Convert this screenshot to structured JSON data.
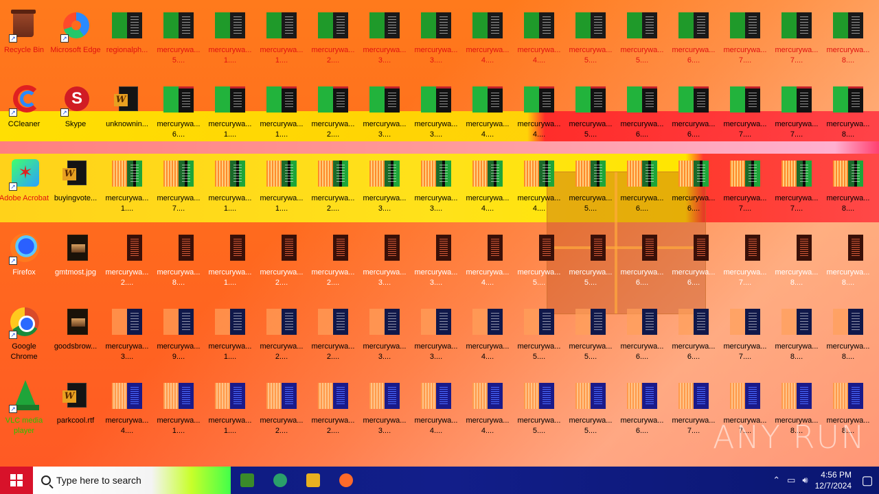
{
  "desktop": {
    "row1": [
      {
        "label": "Recycle Bin",
        "kind": "bin",
        "color": "red"
      },
      {
        "label": "Microsoft Edge",
        "kind": "edge",
        "color": "red"
      },
      {
        "label": "regionalph...",
        "kind": "file",
        "color": "red"
      },
      {
        "label": "mercurywa... 5....",
        "kind": "file",
        "color": "red"
      },
      {
        "label": "mercurywa... 1....",
        "kind": "file",
        "color": "red"
      },
      {
        "label": "mercurywa... 1....",
        "kind": "file",
        "color": "red"
      },
      {
        "label": "mercurywa... 2....",
        "kind": "file",
        "color": "red"
      },
      {
        "label": "mercurywa... 3....",
        "kind": "file",
        "color": "red"
      },
      {
        "label": "mercurywa... 3....",
        "kind": "file",
        "color": "red"
      },
      {
        "label": "mercurywa... 4....",
        "kind": "file",
        "color": "red"
      },
      {
        "label": "mercurywa... 4....",
        "kind": "file",
        "color": "red"
      },
      {
        "label": "mercurywa... 5....",
        "kind": "file",
        "color": "red"
      },
      {
        "label": "mercurywa... 5....",
        "kind": "file",
        "color": "red"
      },
      {
        "label": "mercurywa... 6....",
        "kind": "file",
        "color": "red"
      },
      {
        "label": "mercurywa... 7....",
        "kind": "file",
        "color": "red"
      },
      {
        "label": "mercurywa... 7....",
        "kind": "file",
        "color": "red"
      },
      {
        "label": "mercurywa... 8....",
        "kind": "file",
        "color": "red"
      }
    ],
    "row2": [
      {
        "label": "CCleaner",
        "kind": "ccleaner"
      },
      {
        "label": "Skype",
        "kind": "skype"
      },
      {
        "label": "unknownin...",
        "kind": "word"
      },
      {
        "label": "mercurywa... 6....",
        "kind": "file"
      },
      {
        "label": "mercurywa... 1....",
        "kind": "file"
      },
      {
        "label": "mercurywa... 1....",
        "kind": "file"
      },
      {
        "label": "mercurywa... 2....",
        "kind": "file"
      },
      {
        "label": "mercurywa... 3....",
        "kind": "file"
      },
      {
        "label": "mercurywa... 3....",
        "kind": "file"
      },
      {
        "label": "mercurywa... 4....",
        "kind": "file"
      },
      {
        "label": "mercurywa... 4....",
        "kind": "file"
      },
      {
        "label": "mercurywa... 5....",
        "kind": "file"
      },
      {
        "label": "mercurywa... 6....",
        "kind": "file"
      },
      {
        "label": "mercurywa... 6....",
        "kind": "file"
      },
      {
        "label": "mercurywa... 7....",
        "kind": "file"
      },
      {
        "label": "mercurywa... 7....",
        "kind": "file"
      },
      {
        "label": "mercurywa... 8....",
        "kind": "file"
      }
    ],
    "row3": [
      {
        "label": "Adobe Acrobat",
        "kind": "acrobat"
      },
      {
        "label": "buyingvote...",
        "kind": "word"
      },
      {
        "label": "mercurywa... 1....",
        "kind": "file"
      },
      {
        "label": "mercurywa... 7....",
        "kind": "file"
      },
      {
        "label": "mercurywa... 1....",
        "kind": "file"
      },
      {
        "label": "mercurywa... 1....",
        "kind": "file"
      },
      {
        "label": "mercurywa... 2....",
        "kind": "file"
      },
      {
        "label": "mercurywa... 3....",
        "kind": "file"
      },
      {
        "label": "mercurywa... 3....",
        "kind": "file"
      },
      {
        "label": "mercurywa... 4....",
        "kind": "file"
      },
      {
        "label": "mercurywa... 4....",
        "kind": "file"
      },
      {
        "label": "mercurywa... 5....",
        "kind": "file"
      },
      {
        "label": "mercurywa... 6....",
        "kind": "file"
      },
      {
        "label": "mercurywa... 6....",
        "kind": "file"
      },
      {
        "label": "mercurywa... 7....",
        "kind": "file"
      },
      {
        "label": "mercurywa... 7....",
        "kind": "file"
      },
      {
        "label": "mercurywa... 8....",
        "kind": "file"
      }
    ],
    "row4": [
      {
        "label": "Firefox",
        "kind": "firefox"
      },
      {
        "label": "gmtmost.jpg",
        "kind": "image"
      },
      {
        "label": "mercurywa... 2....",
        "kind": "file"
      },
      {
        "label": "mercurywa... 8....",
        "kind": "file"
      },
      {
        "label": "mercurywa... 1....",
        "kind": "file"
      },
      {
        "label": "mercurywa... 2....",
        "kind": "file"
      },
      {
        "label": "mercurywa... 2....",
        "kind": "file"
      },
      {
        "label": "mercurywa... 3....",
        "kind": "file"
      },
      {
        "label": "mercurywa... 3....",
        "kind": "file"
      },
      {
        "label": "mercurywa... 4....",
        "kind": "file"
      },
      {
        "label": "mercurywa... 5....",
        "kind": "file"
      },
      {
        "label": "mercurywa... 5....",
        "kind": "file"
      },
      {
        "label": "mercurywa... 6....",
        "kind": "file"
      },
      {
        "label": "mercurywa... 6....",
        "kind": "file"
      },
      {
        "label": "mercurywa... 7....",
        "kind": "file"
      },
      {
        "label": "mercurywa... 8....",
        "kind": "file"
      },
      {
        "label": "mercurywa... 8....",
        "kind": "file"
      }
    ],
    "row5": [
      {
        "label": "Google Chrome",
        "kind": "chrome"
      },
      {
        "label": "goodsbrow...",
        "kind": "image"
      },
      {
        "label": "mercurywa... 3....",
        "kind": "file"
      },
      {
        "label": "mercurywa... 9....",
        "kind": "file"
      },
      {
        "label": "mercurywa... 1....",
        "kind": "file"
      },
      {
        "label": "mercurywa... 2....",
        "kind": "file"
      },
      {
        "label": "mercurywa... 2....",
        "kind": "file"
      },
      {
        "label": "mercurywa... 3....",
        "kind": "file"
      },
      {
        "label": "mercurywa... 3....",
        "kind": "file"
      },
      {
        "label": "mercurywa... 4....",
        "kind": "file"
      },
      {
        "label": "mercurywa... 5....",
        "kind": "file"
      },
      {
        "label": "mercurywa... 5....",
        "kind": "file"
      },
      {
        "label": "mercurywa... 6....",
        "kind": "file"
      },
      {
        "label": "mercurywa... 6....",
        "kind": "file"
      },
      {
        "label": "mercurywa... 7....",
        "kind": "file"
      },
      {
        "label": "mercurywa... 8....",
        "kind": "file"
      },
      {
        "label": "mercurywa... 8....",
        "kind": "file"
      }
    ],
    "row6": [
      {
        "label": "VLC media player",
        "kind": "vlc"
      },
      {
        "label": "parkcool.rtf",
        "kind": "word"
      },
      {
        "label": "mercurywa... 4....",
        "kind": "file"
      },
      {
        "label": "mercurywa... 1....",
        "kind": "file"
      },
      {
        "label": "mercurywa... 1....",
        "kind": "file"
      },
      {
        "label": "mercurywa... 2....",
        "kind": "file"
      },
      {
        "label": "mercurywa... 2....",
        "kind": "file"
      },
      {
        "label": "mercurywa... 3....",
        "kind": "file"
      },
      {
        "label": "mercurywa... 4....",
        "kind": "file"
      },
      {
        "label": "mercurywa... 4....",
        "kind": "file"
      },
      {
        "label": "mercurywa... 5....",
        "kind": "file"
      },
      {
        "label": "mercurywa... 5....",
        "kind": "file"
      },
      {
        "label": "mercurywa... 6....",
        "kind": "file"
      },
      {
        "label": "mercurywa... 7....",
        "kind": "file"
      },
      {
        "label": "mercurywa... 7....",
        "kind": "file"
      },
      {
        "label": "mercurywa... 8....",
        "kind": "file"
      },
      {
        "label": "mercurywa... 8....",
        "kind": "file"
      }
    ]
  },
  "watermark": "ANY RUN",
  "taskbar": {
    "search_placeholder": "Type here to search",
    "time": "4:56 PM",
    "date": "12/7/2024",
    "pinned": [
      {
        "name": "task-view",
        "color": "#3a8a2a"
      },
      {
        "name": "edge",
        "color": "#2aa06a"
      },
      {
        "name": "file-explorer",
        "color": "#e8b020"
      },
      {
        "name": "firefox",
        "color": "#ff6a2a"
      }
    ]
  },
  "colors": {
    "background": "#ff6a1e",
    "taskbar": "#0a1a7a",
    "start": "#d8122a"
  }
}
